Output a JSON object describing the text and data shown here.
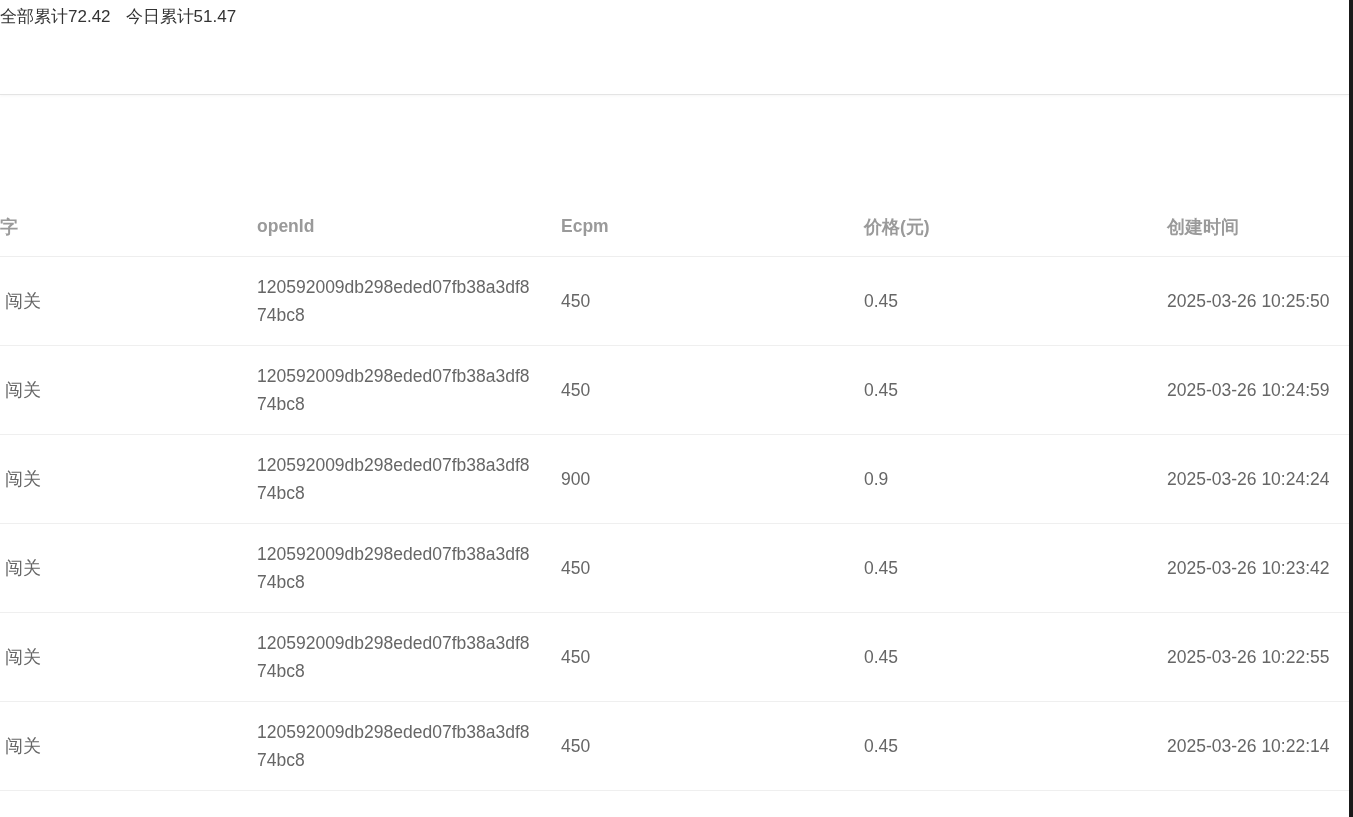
{
  "summary": {
    "total": "全部累计72.42",
    "today": "今日累计51.47"
  },
  "table": {
    "columns": [
      "字",
      "openId",
      "Ecpm",
      "价格(元)",
      "创建时间"
    ],
    "rows": [
      [
        "闯关",
        "120592009db298eded07fb38a3df874bc8",
        "450",
        "0.45",
        "2025-03-26 10:25:50"
      ],
      [
        "闯关",
        "120592009db298eded07fb38a3df874bc8",
        "450",
        "0.45",
        "2025-03-26 10:24:59"
      ],
      [
        "闯关",
        "120592009db298eded07fb38a3df874bc8",
        "900",
        "0.9",
        "2025-03-26 10:24:24"
      ],
      [
        "闯关",
        "120592009db298eded07fb38a3df874bc8",
        "450",
        "0.45",
        "2025-03-26 10:23:42"
      ],
      [
        "闯关",
        "120592009db298eded07fb38a3df874bc8",
        "450",
        "0.45",
        "2025-03-26 10:22:55"
      ],
      [
        "闯关",
        "120592009db298eded07fb38a3df874bc8",
        "450",
        "0.45",
        "2025-03-26 10:22:14"
      ]
    ]
  }
}
